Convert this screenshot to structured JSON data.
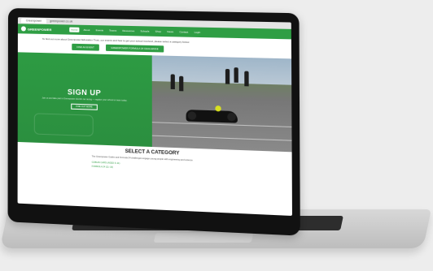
{
  "browser": {
    "tab_title": "Greenpower",
    "tab_url": "greenpower.co.uk"
  },
  "nav": {
    "logo_text": "GREENPOWER",
    "items": [
      "Home",
      "About",
      "Events",
      "Teams",
      "Resources",
      "Schools",
      "Shop",
      "News",
      "Contact",
      "Login"
    ]
  },
  "intro": {
    "text": "To find out more about Greenpower Education Trust, our events and how to get your school involved, please select a category below.",
    "button_left": "FIND AN EVENT",
    "button_right": "GREENPOWER FORMULA 24 CHALLENGE"
  },
  "hero": {
    "title": "SIGN UP",
    "subtitle": "Join us and take part in Greenpower electric car racing — register your school or team today.",
    "button": "FIND OUT MORE"
  },
  "category": {
    "title": "SELECT A CATEGORY",
    "text": "The Greenpower Goblin and Formula 24 challenges engage young people with engineering and science.",
    "link1": "GOBLIN CARS (AGED 9–11)",
    "link2": "FORMULA 24 (11–16)"
  },
  "colors": {
    "brand": "#2f9e44"
  }
}
